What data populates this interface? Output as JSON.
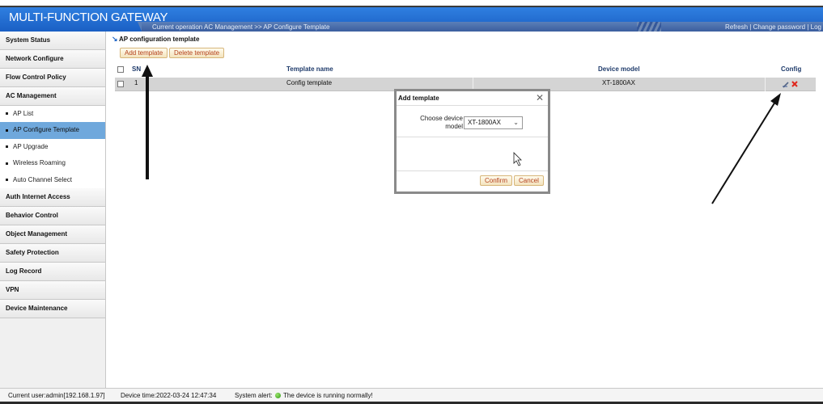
{
  "app": {
    "title": "MULTI-FUNCTION GATEWAY",
    "breadcrumb": "Current operation  AC Management >> AP Configure Template",
    "header_links": [
      "Refresh",
      "Change password",
      "Log"
    ]
  },
  "sidebar": {
    "sections_top": [
      {
        "label": "System Status"
      },
      {
        "label": "Network Configure"
      },
      {
        "label": "Flow Control Policy"
      },
      {
        "label": "AC Management"
      }
    ],
    "sub_items": [
      {
        "label": "AP List",
        "active": false
      },
      {
        "label": "AP Configure Template",
        "active": true
      },
      {
        "label": "AP Upgrade",
        "active": false
      },
      {
        "label": "Wireless Roaming",
        "active": false
      },
      {
        "label": "Auto Channel Select",
        "active": false
      }
    ],
    "sections_bottom": [
      {
        "label": "Auth Internet Access"
      },
      {
        "label": "Behavior Control"
      },
      {
        "label": "Object Management"
      },
      {
        "label": "Safety Protection"
      },
      {
        "label": "Log Record"
      },
      {
        "label": "VPN"
      },
      {
        "label": "Device Maintenance"
      }
    ]
  },
  "main": {
    "title": "AP configuration template",
    "add_button": "Add template",
    "delete_button": "Delete template",
    "table": {
      "headers": {
        "sn": "SN",
        "name": "Template name",
        "model": "Device model",
        "config": "Config"
      },
      "rows": [
        {
          "sn": "1",
          "name": "Config template",
          "model": "XT-1800AX"
        }
      ]
    }
  },
  "dialog": {
    "title": "Add template",
    "field_label": "Choose device model",
    "selected_model": "XT-1800AX",
    "confirm": "Confirm",
    "cancel": "Cancel"
  },
  "status": {
    "user": "Current user:admin[192.168.1.97]",
    "device_time": "Device time:2022-03-24 12:47:34",
    "alert_label": "System alert:",
    "alert_text": "The device is running normally!"
  },
  "colors": {
    "header_blue": "#1a5fc4",
    "active_menu": "#6fa8dc",
    "button_text": "#b4421d",
    "status_ok": "#2f9a16"
  }
}
